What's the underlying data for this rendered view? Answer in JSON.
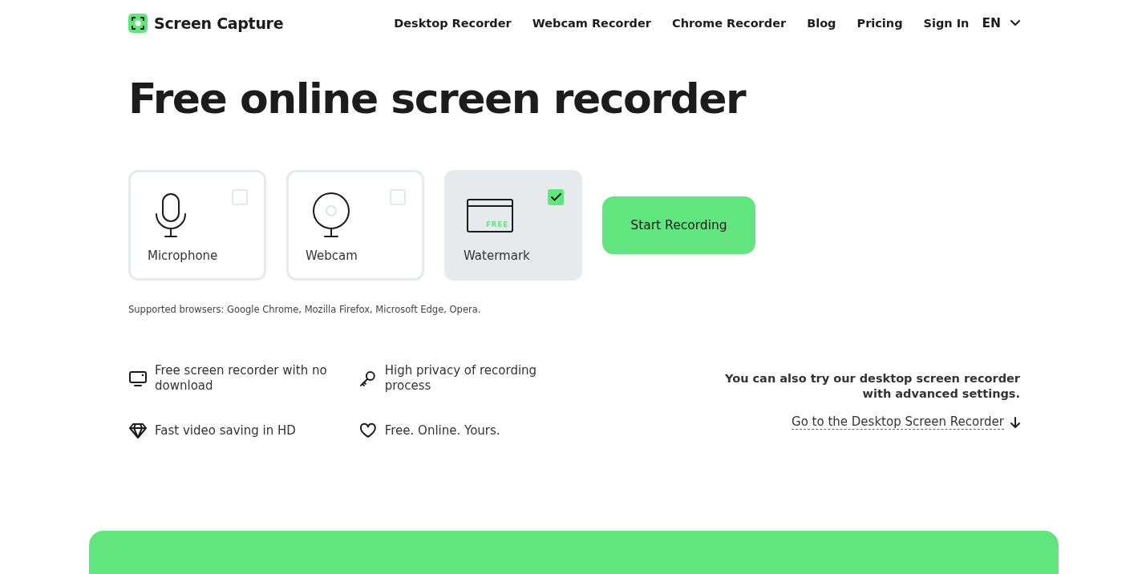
{
  "header": {
    "logo": "Screen Capture",
    "nav": [
      "Desktop Recorder",
      "Webcam Recorder",
      "Chrome Recorder",
      "Blog",
      "Pricing",
      "Sign In"
    ],
    "language": "EN"
  },
  "title": "Free online screen recorder",
  "options": [
    {
      "kind": "microphone",
      "label": "Microphone",
      "checked": false
    },
    {
      "kind": "webcam",
      "label": "Webcam",
      "checked": false
    },
    {
      "kind": "watermark",
      "label": "Watermark",
      "checked": true,
      "badge": "FREE"
    }
  ],
  "start_button": "Start Recording",
  "supported_browsers": "Supported browsers: Google Chrome, Mozilla Firefox, Microsoft Edge, Opera.",
  "features": [
    {
      "kind": "monitor",
      "text": "Free screen recorder with no download"
    },
    {
      "kind": "key",
      "text": "High privacy of recording process"
    },
    {
      "kind": "diamond",
      "text": "Fast video saving in HD"
    },
    {
      "kind": "heart",
      "text": "Free. Online. Yours."
    }
  ],
  "desktop_promo": {
    "text": "You can also try our desktop screen recorder with advanced settings.",
    "link": "Go to the Desktop Screen Recorder"
  }
}
